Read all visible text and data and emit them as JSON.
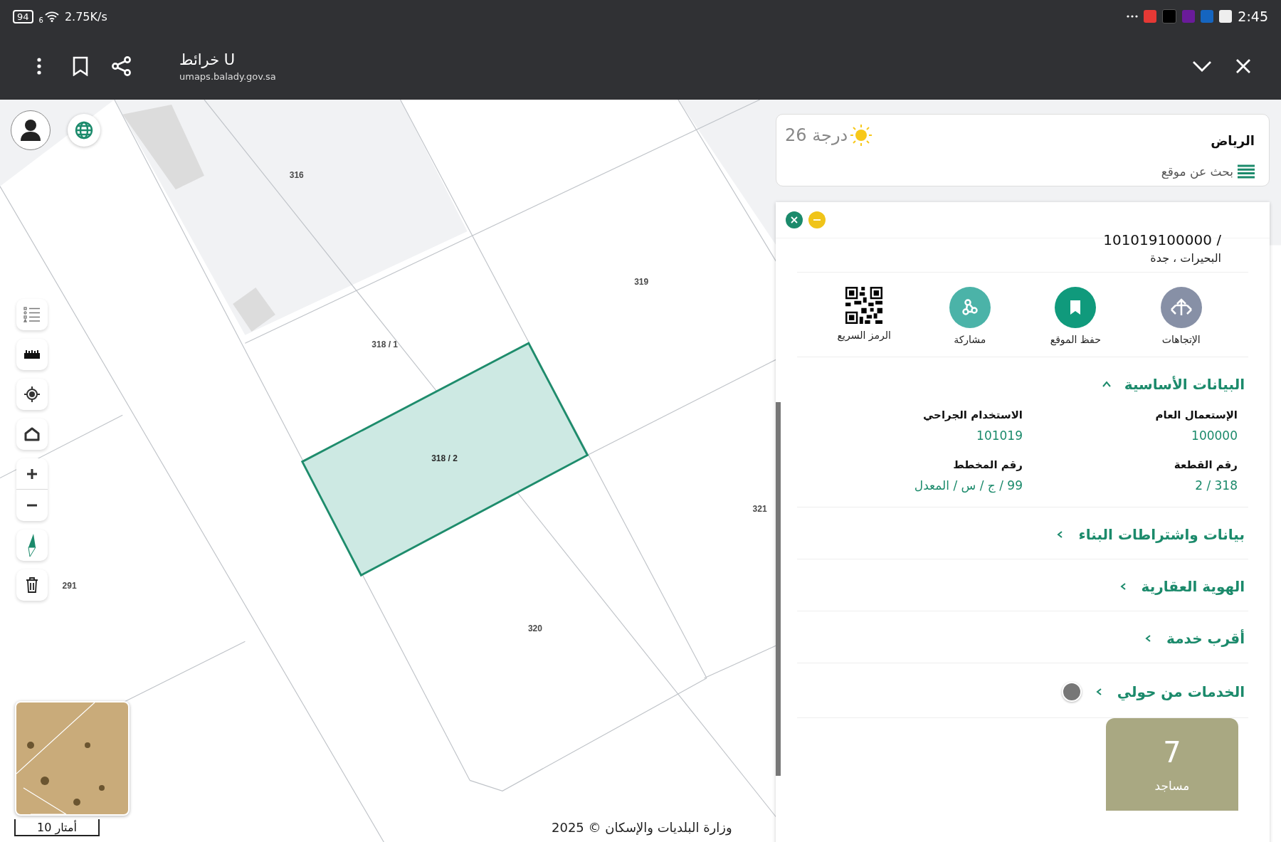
{
  "status_bar": {
    "battery": "94",
    "signal_label": "6",
    "network_speed": "2.75K/s",
    "time": "2:45"
  },
  "app_bar": {
    "title": "خرائط U",
    "url": "umaps.balady.gov.sa"
  },
  "map": {
    "parcels": [
      {
        "label": "316",
        "selected": false
      },
      {
        "label": "319",
        "selected": false
      },
      {
        "label": "318 / 1",
        "selected": false
      },
      {
        "label": "318 / 2",
        "selected": true
      },
      {
        "label": "321",
        "selected": false
      },
      {
        "label": "320",
        "selected": false
      },
      {
        "label": "291",
        "selected": false
      }
    ],
    "scale_label": "10 أمتار",
    "copyright": "وزارة البلديات والإسكان © 2025"
  },
  "location_card": {
    "city": "الرياض",
    "temperature": "26 درجة",
    "search_placeholder": "بحث عن موقع"
  },
  "parcel_panel": {
    "parcel_id": "/ 101019100000",
    "address": "البحيرات ، جدة",
    "actions": [
      {
        "label": "الإتجاهات",
        "kind": "directions"
      },
      {
        "label": "حفظ الموقع",
        "kind": "save"
      },
      {
        "label": "مشاركة",
        "kind": "share"
      },
      {
        "label": "الرمز السريع",
        "kind": "qr"
      }
    ],
    "sections": [
      {
        "title": "البيانات الأساسية",
        "expanded": true,
        "fields": [
          {
            "label": "الإستعمال العام",
            "value": "100000"
          },
          {
            "label": "الاستخدام الجراحي",
            "value": "101019"
          },
          {
            "label": "رقم القطعة",
            "value": "318 / 2"
          },
          {
            "label": "رقم المخطط",
            "value": "99 / ج / س / المعدل"
          }
        ]
      },
      {
        "title": "بيانات واشتراطات البناء",
        "expanded": false
      },
      {
        "title": "الهوية العقارية",
        "expanded": false
      },
      {
        "title": "أقرب خدمة",
        "expanded": false
      },
      {
        "title": "الخدمات من حولي",
        "expanded": false
      }
    ],
    "services": [
      {
        "count": "7",
        "label": "مساجد"
      }
    ]
  }
}
